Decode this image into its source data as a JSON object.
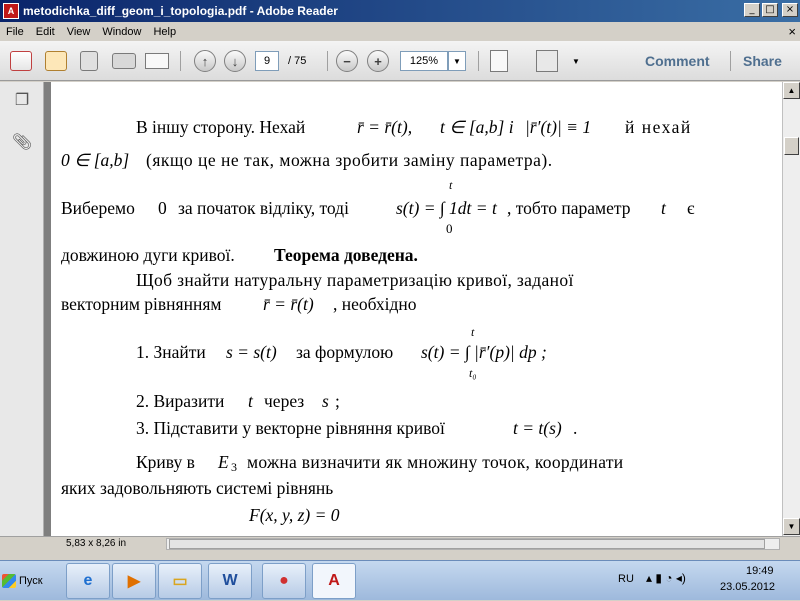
{
  "window": {
    "title": "metodichka_diff_geom_i_topologia.pdf - Adobe Reader",
    "app_icon": "pdf-icon",
    "controls": [
      "_",
      "□",
      "×"
    ]
  },
  "menu": [
    "File",
    "Edit",
    "View",
    "Window",
    "Help"
  ],
  "menu_close": "×",
  "toolbar": {
    "page_current": "9",
    "page_total": "/ 75",
    "zoom": "125%",
    "comment": "Comment",
    "share": "Share",
    "icons": [
      "create-pdf-icon",
      "edit-icon",
      "save-icon",
      "print-icon",
      "email-icon",
      "prev-page-icon",
      "next-page-icon",
      "zoom-out-icon",
      "zoom-in-icon",
      "fit-page-icon",
      "fullscreen-icon"
    ]
  },
  "side_panel": {
    "icons": [
      "pages-icon",
      "attachments-icon"
    ]
  },
  "document": {
    "l1a": "В іншу сторону. Нехай",
    "l1_vec": "r̄ = r̄(t),",
    "l1_in": "t ∈ [a,b] і",
    "l1_norm": "|r̄′(t)| ≡ 1",
    "l1b": "й нехай",
    "l2_mem": "0 ∈ [a,b]",
    "l2": "(якщо це не так, можна зробити заміну параметра).",
    "l3a": "Виберемо",
    "l3_zero": "0",
    "l3b": "за початок відліку, тоді",
    "l3_int": "s(t) = ∫ 1dt = t",
    "l3_up": "t",
    "l3_lo": "0",
    "l3c": ", тобто параметр",
    "l3_t": "t",
    "l3d": "є",
    "l4a": "довжиною дуги кривої.",
    "l4b": "Теорема доведена.",
    "l5": "Щоб знайти натуральну параметризацію кривої, заданої",
    "l6a": "векторним рівнянням",
    "l6_vec": "r̄ = r̄(t)",
    "l6b": ", необхідно",
    "i1a": "1. Знайти",
    "i1_eq": "s = s(t)",
    "i1b": "за формулою",
    "i1_int": "s(t) = ∫ |r̄′(p)| dp ;",
    "i1_up": "t",
    "i1_lo": "t₀",
    "i2a": "2. Виразити",
    "i2_t": "t",
    "i2b": "через",
    "i2_s": "s",
    "i2c": ";",
    "i3a": "3. Підставити у векторне рівняння кривої",
    "i3_eq": "t = t(s)",
    "i3b": ".",
    "p1a": "Криву в",
    "p1_e": "E",
    "p1_sub": "3",
    "p1b": "можна визначити як множину точок, координати",
    "p2": "яких задовольняють системі рівнянь",
    "sys1": "F(x, y, z) = 0"
  },
  "status": {
    "size": "5,83 x 8,26 in"
  },
  "taskbar": {
    "start": "Пуск",
    "apps": [
      "internet-explorer-icon",
      "media-player-icon",
      "explorer-icon",
      "word-icon",
      "chrome-icon",
      "adobe-reader-icon"
    ],
    "lang": "RU",
    "time": "19:49",
    "date": "23.05.2012"
  }
}
